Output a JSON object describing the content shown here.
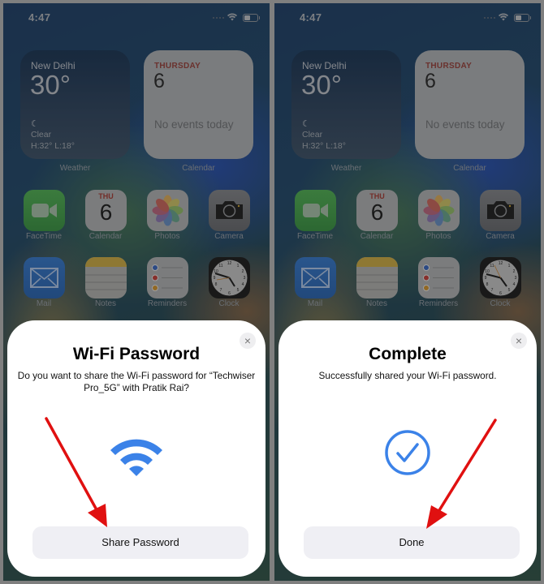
{
  "status_bar": {
    "time": "4:47",
    "wifi_icon": "wifi-icon",
    "battery_icon": "battery-icon"
  },
  "weather_widget": {
    "city": "New Delhi",
    "temperature": "30°",
    "condition_icon": "moon-icon",
    "condition": "Clear",
    "high_low": "H:32° L:18°",
    "label": "Weather"
  },
  "calendar_widget": {
    "day": "THURSDAY",
    "date": "6",
    "events": "No events today",
    "label": "Calendar"
  },
  "apps": [
    {
      "name": "FaceTime"
    },
    {
      "name": "Calendar",
      "day": "THU",
      "date": "6"
    },
    {
      "name": "Photos"
    },
    {
      "name": "Camera"
    },
    {
      "name": "Mail"
    },
    {
      "name": "Notes"
    },
    {
      "name": "Reminders"
    },
    {
      "name": "Clock"
    }
  ],
  "left_sheet": {
    "title": "Wi-Fi Password",
    "message": "Do you want to share the Wi-Fi password for “Techwiser Pro_5G” with Pratik Rai?",
    "icon": "wifi-icon",
    "button_label": "Share Password",
    "close_icon": "×"
  },
  "right_sheet": {
    "title": "Complete",
    "message": "Successfully shared your Wi-Fi password.",
    "icon": "checkmark-circle-icon",
    "button_label": "Done",
    "close_icon": "×"
  },
  "colors": {
    "accent_blue": "#3b82e8",
    "annotation_red": "#e01010",
    "frame_grey": "#7f7f7f"
  }
}
